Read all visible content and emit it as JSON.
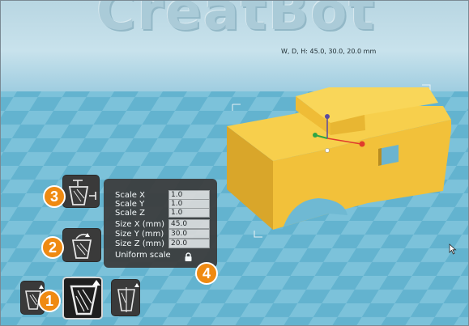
{
  "scene": {
    "brand_wall_text": "CreatBot",
    "dimensions_label": "W, D, H: 45.0, 30.0, 20.0 mm",
    "colors": {
      "model": "#f2c13a",
      "floor": "#5fb0cd",
      "panel": "#3b3b3b",
      "badge": "#ef8a12"
    }
  },
  "scale_panel": {
    "rows": [
      {
        "label": "Scale X",
        "value": "1.0"
      },
      {
        "label": "Scale Y",
        "value": "1.0"
      },
      {
        "label": "Scale Z",
        "value": "1.0"
      },
      {
        "label": "Size X (mm)",
        "value": "45.0"
      },
      {
        "label": "Size Y (mm)",
        "value": "30.0"
      },
      {
        "label": "Size Z (mm)",
        "value": "20.0"
      }
    ],
    "uniform_label": "Uniform scale",
    "lock_icon": "lock-icon"
  },
  "toolbar": {
    "tools": [
      {
        "icon": "rotate-tool-icon"
      },
      {
        "icon": "scale-tool-icon",
        "active": true
      },
      {
        "icon": "mirror-tool-icon"
      },
      {
        "icon": "lay-flat-icon"
      },
      {
        "icon": "max-size-icon"
      }
    ]
  },
  "badges": [
    "1",
    "2",
    "3",
    "4"
  ]
}
